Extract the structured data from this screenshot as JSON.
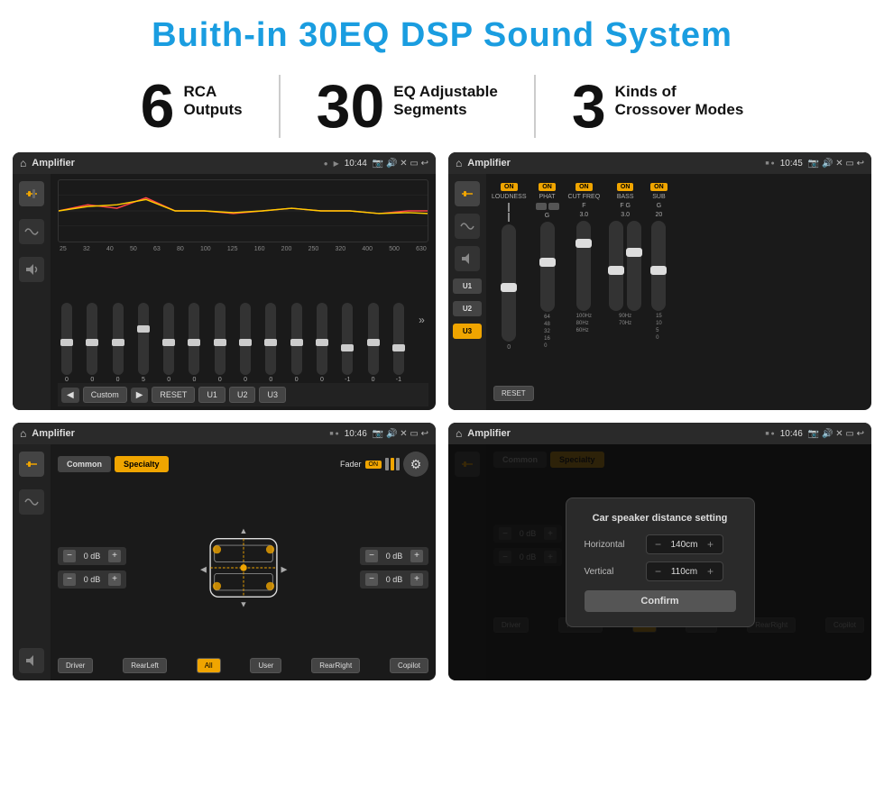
{
  "header": {
    "title": "Buith-in 30EQ DSP Sound System"
  },
  "stats": [
    {
      "number": "6",
      "label_line1": "RCA",
      "label_line2": "Outputs"
    },
    {
      "number": "30",
      "label_line1": "EQ Adjustable",
      "label_line2": "Segments"
    },
    {
      "number": "3",
      "label_line1": "Kinds of",
      "label_line2": "Crossover Modes"
    }
  ],
  "screens": [
    {
      "id": "screen1",
      "topbar": {
        "title": "Amplifier",
        "time": "10:44"
      },
      "type": "eq",
      "eq_freqs": [
        "25",
        "32",
        "40",
        "50",
        "63",
        "80",
        "100",
        "125",
        "160",
        "200",
        "250",
        "320",
        "400",
        "500",
        "630"
      ],
      "eq_values": [
        "0",
        "0",
        "0",
        "5",
        "0",
        "0",
        "0",
        "0",
        "0",
        "0",
        "0",
        "-1",
        "0",
        "-1"
      ],
      "presets": [
        "Custom",
        "RESET",
        "U1",
        "U2",
        "U3"
      ]
    },
    {
      "id": "screen2",
      "topbar": {
        "title": "Amplifier",
        "time": "10:45"
      },
      "type": "amplifier",
      "presets": [
        "U1",
        "U2",
        "U3"
      ],
      "controls": [
        "LOUDNESS",
        "PHAT",
        "CUT FREQ",
        "BASS",
        "SUB"
      ],
      "reset_label": "RESET"
    },
    {
      "id": "screen3",
      "topbar": {
        "title": "Amplifier",
        "time": "10:46"
      },
      "type": "speaker",
      "tabs": [
        "Common",
        "Specialty"
      ],
      "fader_label": "Fader",
      "fader_on": "ON",
      "db_values": [
        "0 dB",
        "0 dB",
        "0 dB",
        "0 dB"
      ],
      "buttons": [
        "Driver",
        "RearLeft",
        "All",
        "User",
        "RearRight",
        "Copilot"
      ]
    },
    {
      "id": "screen4",
      "topbar": {
        "title": "Amplifier",
        "time": "10:46"
      },
      "type": "speaker_dialog",
      "tabs": [
        "Common",
        "Specialty"
      ],
      "dialog": {
        "title": "Car speaker distance setting",
        "horizontal_label": "Horizontal",
        "horizontal_value": "140cm",
        "vertical_label": "Vertical",
        "vertical_value": "110cm",
        "confirm_label": "Confirm"
      },
      "db_values": [
        "0 dB",
        "0 dB"
      ],
      "buttons": [
        "Driver",
        "RearLeft",
        "All",
        "User",
        "RearRight",
        "Copilot"
      ]
    }
  ]
}
